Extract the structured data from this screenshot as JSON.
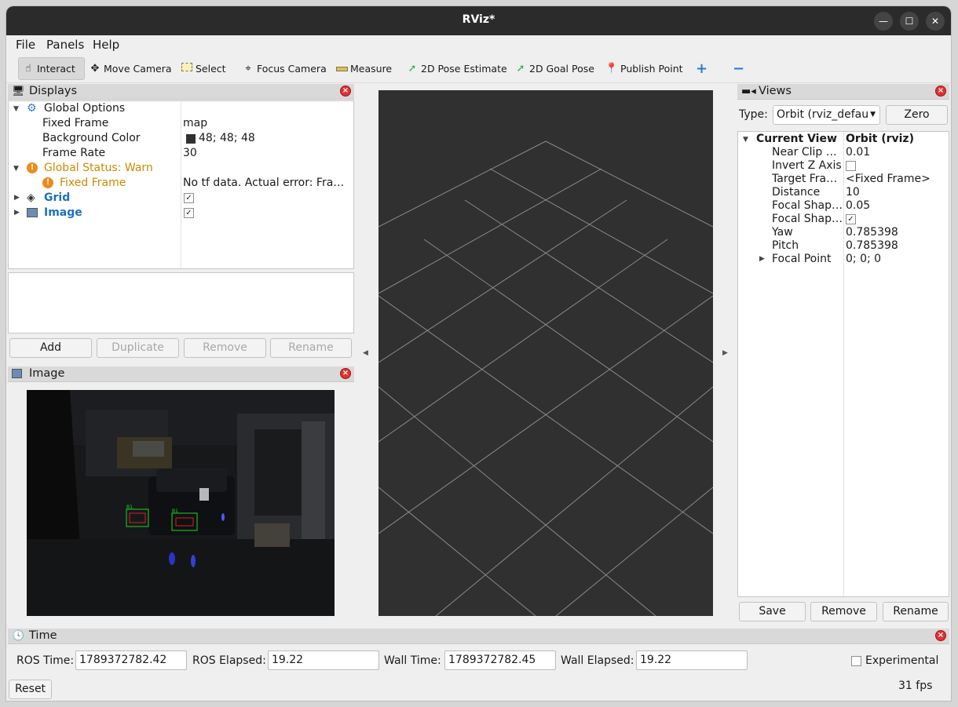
{
  "window": {
    "title": "RViz*"
  },
  "menu": [
    "File",
    "Panels",
    "Help"
  ],
  "toolbar": {
    "interact": "Interact",
    "move_camera": "Move Camera",
    "select": "Select",
    "focus_camera": "Focus Camera",
    "measure": "Measure",
    "pose_estimate": "2D Pose Estimate",
    "goal_pose": "2D Goal Pose",
    "publish_point": "Publish Point"
  },
  "displays": {
    "title": "Displays",
    "global_options": "Global Options",
    "fixed_frame_label": "Fixed Frame",
    "fixed_frame_value": "map",
    "bg_color_label": "Background Color",
    "bg_color_value": "48; 48; 48",
    "bg_color_swatch": "#303030",
    "frame_rate_label": "Frame Rate",
    "frame_rate_value": "30",
    "global_status": "Global Status: Warn",
    "status_fixed_frame": "Fixed Frame",
    "status_error": "No tf data.  Actual error: Fra…",
    "grid": "Grid",
    "image": "Image",
    "warn_color": "#c98b00",
    "link_color": "#1f6fbf"
  },
  "display_buttons": {
    "add": "Add",
    "duplicate": "Duplicate",
    "remove": "Remove",
    "rename": "Rename"
  },
  "image_panel": {
    "title": "Image",
    "box_labels": [
      "B1",
      "B1"
    ]
  },
  "views": {
    "title": "Views",
    "type_label": "Type:",
    "type_value": "Orbit (rviz_defau",
    "zero": "Zero",
    "current_view": "Current View",
    "current_view_value": "Orbit (rviz)",
    "props": [
      {
        "label": "Near Clip …",
        "value": "0.01"
      },
      {
        "label": "Invert Z Axis",
        "value": ""
      },
      {
        "label": "Target Fra…",
        "value": "<Fixed Frame>"
      },
      {
        "label": "Distance",
        "value": "10"
      },
      {
        "label": "Focal Shap…",
        "value": "0.05"
      },
      {
        "label": "Focal Shap…",
        "value": ""
      },
      {
        "label": "Yaw",
        "value": "0.785398"
      },
      {
        "label": "Pitch",
        "value": "0.785398"
      },
      {
        "label": "Focal Point",
        "value": "0; 0; 0"
      }
    ],
    "save": "Save",
    "remove": "Remove",
    "rename": "Rename"
  },
  "time": {
    "title": "Time",
    "ros_time_label": "ROS Time:",
    "ros_time": "1789372782.42",
    "ros_elapsed_label": "ROS Elapsed:",
    "ros_elapsed": "19.22",
    "wall_time_label": "Wall Time:",
    "wall_time": "1789372782.45",
    "wall_elapsed_label": "Wall Elapsed:",
    "wall_elapsed": "19.22",
    "experimental": "Experimental",
    "reset": "Reset",
    "fps": "31 fps"
  }
}
